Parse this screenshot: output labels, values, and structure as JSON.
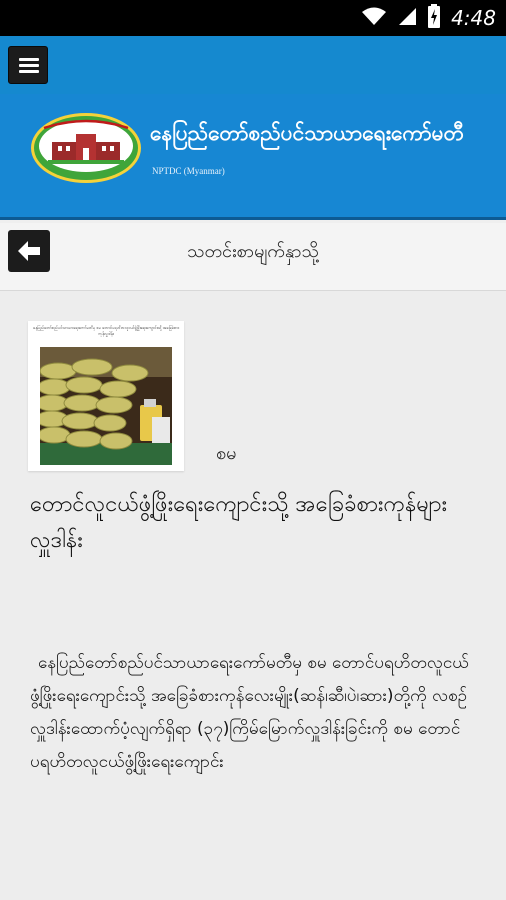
{
  "status_bar": {
    "time": "4:48",
    "wifi_icon": "wifi-icon",
    "signal_icon": "signal-icon",
    "battery_icon": "battery-charging-icon"
  },
  "app_bar": {
    "menu_icon": "hamburger-menu-icon"
  },
  "banner": {
    "title": "နေပြည်တော်စည်ပင်သာယာရေးကော်မတီ",
    "subtitle": "NPTDC (Myanmar)",
    "logo_caption": "နေပြည်တော်စည်ပင်သာယာရေးကော်မတီ",
    "colors": {
      "brand_blue": "#1787d3",
      "logo_green": "#3fa53a"
    }
  },
  "nav": {
    "back_icon": "back-arrow-icon",
    "title": "သတင်းစာမျက်နှာသို့"
  },
  "article": {
    "thumbnail_caption": "နေပြည်တော်စည်ပင်သာယာရေးကော်မတီမှ စမ တောင်ပရဟိတလူငယ်ဖွံ့ဖြိုးရေးကျောင်းသို့ အခြေခံစားကုန်လှူဒါန်း",
    "source": "စမ",
    "title": "တောင်လူငယ်ဖွံ့ဖြိုးရေးကျောင်းသို့ အခြေခံစားကုန်များလှူဒါန်း",
    "body": "နေပြည်တော်စည်ပင်သာယာရေးကော်မတီမှ စမ တောင်ပရဟိတလူငယ်ဖွံ့ဖြိုးရေးကျောင်းသို့ အခြေခံစားကုန်လေးမျိုး(ဆန်၊ဆီ၊ပဲ၊ဆား)တို့ကို လစဉ်လှူဒါန်းထောက်ပံ့လျက်ရှိရာ (၃၇)ကြိမ်မြောက်လှူဒါန်းခြင်းကို စမ တောင်ပရဟိတလူငယ်ဖွံ့ဖြိုးရေးကျောင်း"
  }
}
